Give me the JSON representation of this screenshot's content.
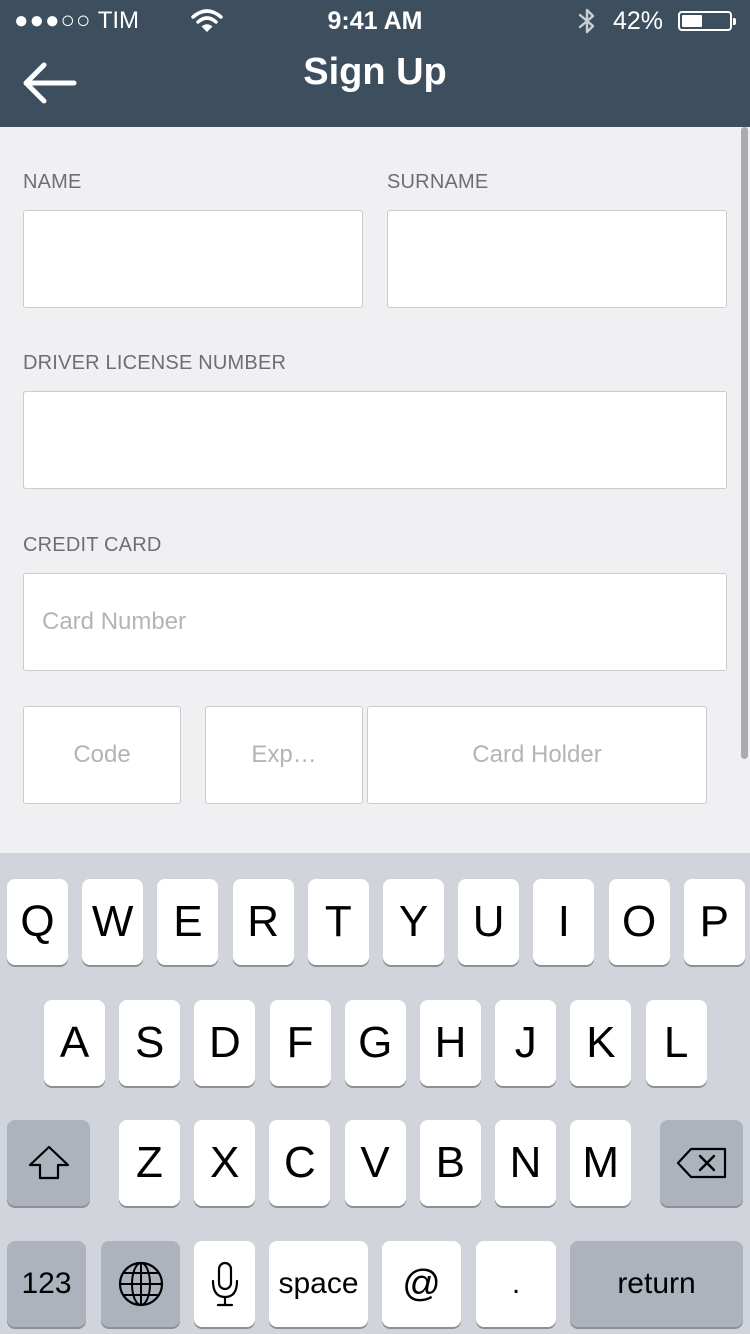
{
  "status_bar": {
    "carrier_dots": "●●●○○",
    "carrier": "TIM",
    "time": "9:41 AM",
    "battery": "42%"
  },
  "header": {
    "title": "Sign Up"
  },
  "form": {
    "name_label": "NAME",
    "surname_label": "SURNAME",
    "license_label": "DRIVER LICENSE NUMBER",
    "credit_card_label": "CREDIT CARD",
    "card_number_placeholder": "Card Number",
    "code_placeholder": "Code",
    "exp_placeholder": "Exp…",
    "card_holder_placeholder": "Card Holder"
  },
  "keyboard": {
    "row1": [
      "Q",
      "W",
      "E",
      "R",
      "T",
      "Y",
      "U",
      "I",
      "O",
      "P"
    ],
    "row2": [
      "A",
      "S",
      "D",
      "F",
      "G",
      "H",
      "J",
      "K",
      "L"
    ],
    "row3": [
      "Z",
      "X",
      "C",
      "V",
      "B",
      "N",
      "M"
    ],
    "numbers_label": "123",
    "space_label": "space",
    "at_label": "@",
    "dot_label": ".",
    "return_label": "return"
  }
}
